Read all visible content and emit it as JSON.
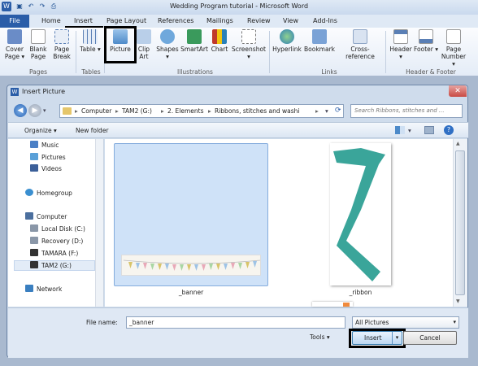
{
  "window": {
    "title": "Wedding Program tutorial  -  Microsoft Word"
  },
  "tabs": [
    "File",
    "Home",
    "Insert",
    "Page Layout",
    "References",
    "Mailings",
    "Review",
    "View",
    "Add-Ins"
  ],
  "ribbon": {
    "buttons": [
      {
        "label": "Cover Page ▾",
        "icon": "cover-page-icon"
      },
      {
        "label": "Blank Page",
        "icon": "blank-page-icon"
      },
      {
        "label": "Page Break",
        "icon": "page-break-icon"
      },
      {
        "label": "Table ▾",
        "icon": "table-icon"
      },
      {
        "label": "Picture",
        "icon": "picture-icon"
      },
      {
        "label": "Clip Art",
        "icon": "clip-art-icon"
      },
      {
        "label": "Shapes ▾",
        "icon": "shapes-icon"
      },
      {
        "label": "SmartArt",
        "icon": "smartart-icon"
      },
      {
        "label": "Chart",
        "icon": "chart-icon"
      },
      {
        "label": "Screenshot ▾",
        "icon": "screenshot-icon"
      },
      {
        "label": "Hyperlink",
        "icon": "hyperlink-icon"
      },
      {
        "label": "Bookmark",
        "icon": "bookmark-icon"
      },
      {
        "label": "Cross-reference",
        "icon": "cross-reference-icon"
      },
      {
        "label": "Header ▾",
        "icon": "header-icon"
      },
      {
        "label": "Footer ▾",
        "icon": "footer-icon"
      },
      {
        "label": "Page Number ▾",
        "icon": "page-number-icon"
      }
    ],
    "groups": [
      "Pages",
      "Tables",
      "Illustrations",
      "Links",
      "Header & Footer"
    ]
  },
  "dialog": {
    "title": "Insert Picture",
    "close": "✕",
    "breadcrumbs": [
      "Computer",
      "TAM2 (G:)",
      "2. Elements",
      "Ribbons, stitches and washi"
    ],
    "search_placeholder": "Search Ribbons, stitches and ...",
    "toolbar": {
      "organize": "Organize ▾",
      "new_folder": "New folder"
    },
    "nav": [
      {
        "label": "Music",
        "icon": "music-icon"
      },
      {
        "label": "Pictures",
        "icon": "pictures-icon"
      },
      {
        "label": "Videos",
        "icon": "videos-icon"
      },
      {
        "label": "Homegroup",
        "icon": "homegroup-icon"
      },
      {
        "label": "Computer",
        "icon": "computer-icon"
      },
      {
        "label": "Local Disk (C:)",
        "icon": "drive-icon"
      },
      {
        "label": "Recovery (D:)",
        "icon": "drive-icon"
      },
      {
        "label": "TAMARA (F:)",
        "icon": "drive-icon"
      },
      {
        "label": "TAM2 (G:)",
        "icon": "drive-icon"
      },
      {
        "label": "Network",
        "icon": "network-icon"
      }
    ],
    "files": [
      {
        "name": "_banner",
        "selected": true
      },
      {
        "name": "_ribbon",
        "selected": false
      }
    ],
    "file_name_label": "File name:",
    "file_name_value": "_banner",
    "file_type": "All Pictures",
    "tools": "Tools ▾",
    "insert": "Insert",
    "cancel": "Cancel"
  },
  "colors": {
    "accent": "#2a5da8",
    "ribbon_teal": "#3aa59a",
    "selection": "#cfe2f8"
  }
}
